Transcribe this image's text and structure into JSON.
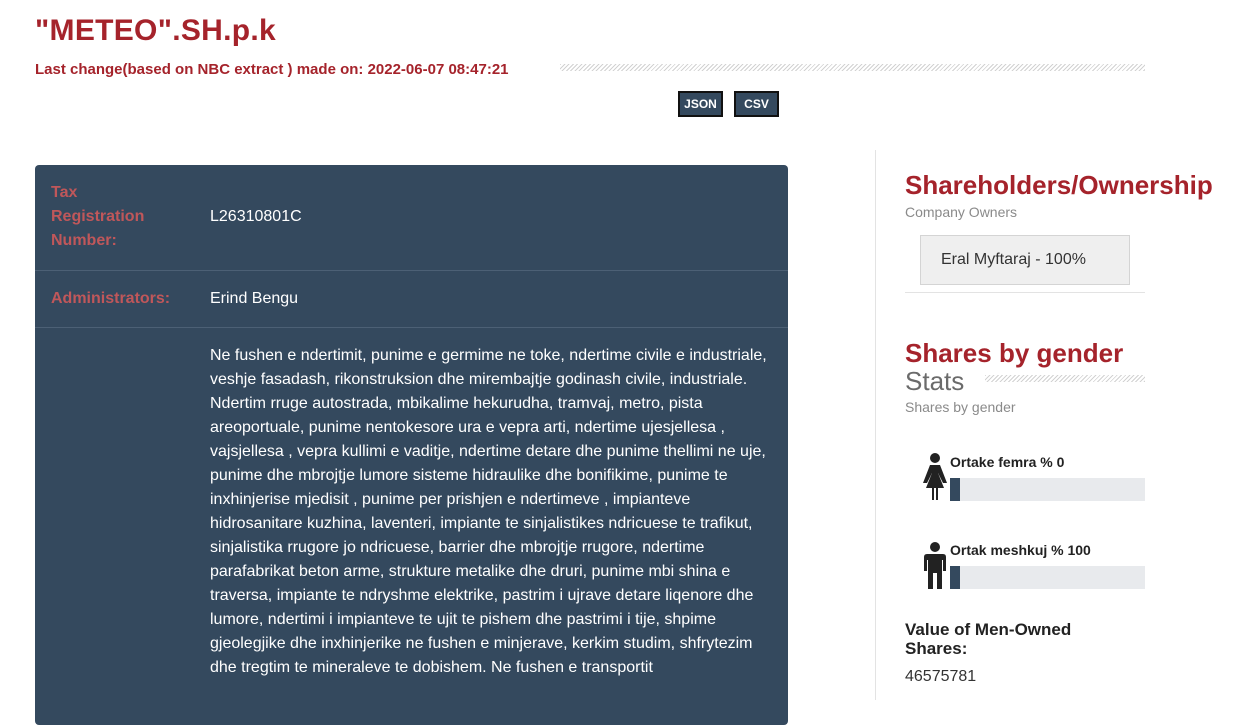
{
  "company": {
    "name": "\"METEO\".SH.p.k",
    "last_change": "Last change(based on NBC extract ) made on: 2022-06-07 08:47:21"
  },
  "exports": {
    "json_label": "JSON",
    "csv_label": "CSV"
  },
  "details": {
    "tax_label": "Tax Registration Number:",
    "tax_value": "L26310801C",
    "admin_label": "Administrators:",
    "admin_value": "Erind Bengu",
    "activity_label": "",
    "activity_text": "Ne fushen e ndertimit, punime e germime ne toke, ndertime civile e industriale, veshje fasadash, rikonstruksion dhe mirembajtje godinash civile, industriale. Ndertim rruge autostrada, mbikalime hekurudha, tramvaj, metro, pista areoportuale, punime nentokesore ura e vepra arti, ndertime ujesjellesa , vajsjellesa , vepra kullimi e vaditje, ndertime detare dhe punime thellimi ne uje, punime dhe mbrojtje lumore sisteme hidraulike dhe bonifikime, punime te inxhinjerise mjedisit , punime per prishjen e ndertimeve , impianteve hidrosanitare kuzhina, laventeri, impiante te sinjalistikes ndricuese te trafikut, sinjalistika rrugore jo ndricuese, barrier dhe mbrojtje rrugore, ndertime parafabrikat beton arme, strukture metalike dhe druri, punime mbi shina e traversa, impiante te ndryshme elektrike, pastrim i ujrave detare liqenore dhe lumore, ndertimi i impianteve te ujit te pishem dhe pastrimi i tije, shpime gjeolegjike dhe inxhinjerike ne fushen e minjerave, kerkim studim, shfrytezim dhe tregtim te mineraleve te dobishem. Ne fushen e transportit"
  },
  "ownership": {
    "title": "Shareholders/Ownership",
    "subtitle": "Company Owners",
    "owners": [
      "Eral Myftaraj - 100%"
    ]
  },
  "gender": {
    "title": "Shares by gender",
    "stats_label": "Stats",
    "subtitle": "Shares by gender",
    "female_label": "Ortake femra % 0",
    "female_pct": 0,
    "male_label": "Ortak meshkuj % 100",
    "male_pct": 100,
    "male_value_label": "Value of Men-Owned Shares:",
    "male_value": "46575781"
  },
  "colors": {
    "accent": "#a5232b",
    "panel": "#34495e",
    "label": "#c0575a"
  },
  "icons": {
    "female": "female-figure-icon",
    "male": "male-figure-icon"
  }
}
